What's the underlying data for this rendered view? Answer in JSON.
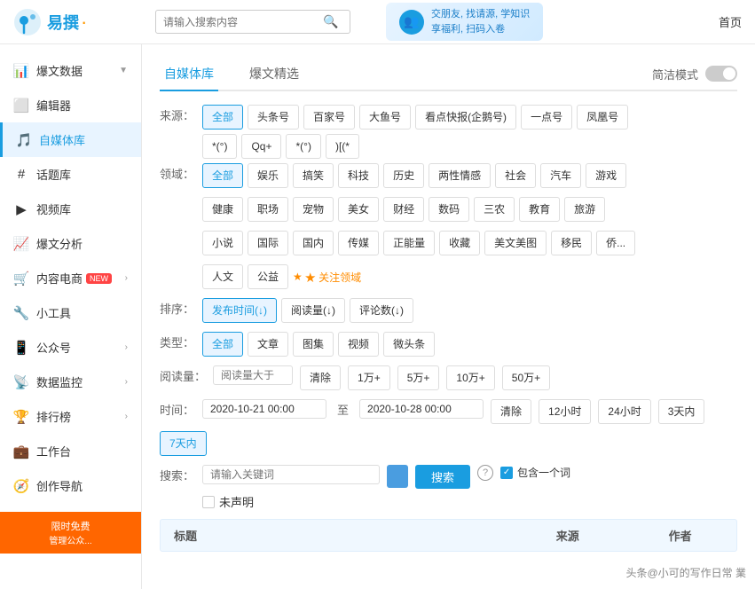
{
  "topbar": {
    "logo_text": "易撰",
    "search_placeholder": "请输入搜索内容",
    "banner_line1": "交朋友, 找请源, 学知识",
    "banner_line2": "享福利, 扫码入卷",
    "home_label": "首页"
  },
  "sidebar": {
    "items": [
      {
        "id": "baowen-data",
        "label": "爆文数据",
        "icon": "📊",
        "arrow": true,
        "active": false
      },
      {
        "id": "bianjiji",
        "label": "编辑器",
        "icon": "✏️",
        "arrow": false,
        "active": false
      },
      {
        "id": "ziwei-tiku",
        "label": "自媒体库",
        "icon": "🎵",
        "arrow": false,
        "active": true
      },
      {
        "id": "huati-ku",
        "label": "话题库",
        "icon": "#",
        "arrow": false,
        "active": false
      },
      {
        "id": "shipin-ku",
        "label": "视频库",
        "icon": "▶",
        "arrow": false,
        "active": false
      },
      {
        "id": "baowen-fenxi",
        "label": "爆文分析",
        "icon": "📈",
        "arrow": false,
        "active": false
      },
      {
        "id": "neirong-dianshang",
        "label": "内容电商",
        "icon": "🛒",
        "badge": "NEW",
        "arrow": true,
        "active": false
      },
      {
        "id": "xiao-gongju",
        "label": "小工具",
        "icon": "",
        "arrow": false,
        "active": false
      },
      {
        "id": "gongzhong-hao",
        "label": "公众号",
        "icon": "",
        "arrow": true,
        "active": false
      },
      {
        "id": "shuju-jiankong",
        "label": "数据监控",
        "icon": "",
        "arrow": true,
        "active": false
      },
      {
        "id": "paihang-bang",
        "label": "排行榜",
        "icon": "",
        "arrow": true,
        "active": false
      },
      {
        "id": "gongzuo-tai",
        "label": "工作台",
        "icon": "",
        "arrow": false,
        "active": false
      },
      {
        "id": "chuangzuo-daohang",
        "label": "创作导航",
        "icon": "",
        "arrow": false,
        "active": false
      }
    ]
  },
  "content": {
    "tabs": [
      {
        "id": "ziwei-tiku-tab",
        "label": "自媒体库",
        "active": true
      },
      {
        "id": "baowen-jingxuan-tab",
        "label": "爆文精选",
        "active": false
      },
      {
        "id": "jianjie-moshi-tab",
        "label": "简洁模式",
        "active": false,
        "toggle": true
      }
    ],
    "source_label": "来源：",
    "sources": [
      {
        "id": "all",
        "label": "全部",
        "active": true
      },
      {
        "id": "toutiao",
        "label": "头条号",
        "active": false
      },
      {
        "id": "baijiahao",
        "label": "百家号",
        "active": false
      },
      {
        "id": "dayu",
        "label": "大鱼号",
        "active": false
      },
      {
        "id": "kandian",
        "label": "看点快报(企鹅号)",
        "active": false
      },
      {
        "id": "yidian",
        "label": "一点号",
        "active": false
      },
      {
        "id": "fenghuang",
        "label": "凤凰号",
        "active": false
      },
      {
        "id": "weibo",
        "label": "*(°)",
        "active": false
      },
      {
        "id": "qq",
        "label": "Qq+",
        "active": false
      },
      {
        "id": "weixing",
        "label": "*(°)",
        "active": false
      },
      {
        "id": "other",
        "label": ")[(*",
        "active": false
      }
    ],
    "domain_label": "领域：",
    "domains_row1": [
      {
        "id": "all",
        "label": "全部",
        "active": true
      },
      {
        "id": "yule",
        "label": "娱乐",
        "active": false
      },
      {
        "id": "gaoxiao",
        "label": "搞笑",
        "active": false
      },
      {
        "id": "keji",
        "label": "科技",
        "active": false
      },
      {
        "id": "lishi",
        "label": "历史",
        "active": false
      },
      {
        "id": "liangxing",
        "label": "两性情感",
        "active": false
      },
      {
        "id": "shehui",
        "label": "社会",
        "active": false
      },
      {
        "id": "qiche",
        "label": "汽车",
        "active": false
      },
      {
        "id": "youxi",
        "label": "游戏",
        "active": false
      }
    ],
    "domains_row2": [
      {
        "id": "jiankang",
        "label": "健康",
        "active": false
      },
      {
        "id": "zhichang",
        "label": "职场",
        "active": false
      },
      {
        "id": "chongwu",
        "label": "宠物",
        "active": false
      },
      {
        "id": "meinv",
        "label": "美女",
        "active": false
      },
      {
        "id": "caijing",
        "label": "财经",
        "active": false
      },
      {
        "id": "shuma",
        "label": "数码",
        "active": false
      },
      {
        "id": "sannong",
        "label": "三农",
        "active": false
      },
      {
        "id": "jiaoyu",
        "label": "教育",
        "active": false
      },
      {
        "id": "lvyou",
        "label": "旅游",
        "active": false
      }
    ],
    "domains_row3": [
      {
        "id": "xiaoshuo",
        "label": "小说",
        "active": false
      },
      {
        "id": "guoji",
        "label": "国际",
        "active": false
      },
      {
        "id": "guonei",
        "label": "国内",
        "active": false
      },
      {
        "id": "chuanmei",
        "label": "传媒",
        "active": false
      },
      {
        "id": "zhengneng",
        "label": "正能量",
        "active": false
      },
      {
        "id": "shoucang",
        "label": "收藏",
        "active": false
      },
      {
        "id": "meinvmei",
        "label": "美文美图",
        "active": false
      },
      {
        "id": "yimin",
        "label": "移民",
        "active": false
      },
      {
        "id": "qinzi",
        "label": "侨...",
        "active": false
      }
    ],
    "domains_row4": [
      {
        "id": "renwen",
        "label": "人文",
        "active": false
      },
      {
        "id": "gongyi",
        "label": "公益",
        "active": false
      }
    ],
    "focus_domain_label": "★ 关注领域",
    "sort_label": "排序：",
    "sorts": [
      {
        "id": "publish-time",
        "label": "发布时间(↓)",
        "active": true
      },
      {
        "id": "read-count",
        "label": "阅读量(↓)",
        "active": false
      },
      {
        "id": "comment-count",
        "label": "评论数(↓)",
        "active": false
      }
    ],
    "type_label": "类型：",
    "types": [
      {
        "id": "all",
        "label": "全部",
        "active": true
      },
      {
        "id": "article",
        "label": "文章",
        "active": false
      },
      {
        "id": "gallery",
        "label": "图集",
        "active": false
      },
      {
        "id": "video",
        "label": "视频",
        "active": false
      },
      {
        "id": "weivideo",
        "label": "微头条",
        "active": false
      }
    ],
    "read_label": "阅读量：",
    "read_placeholder": "阅读量大于",
    "read_clears": [
      {
        "id": "clear",
        "label": "清除"
      },
      {
        "id": "1w",
        "label": "1万+"
      },
      {
        "id": "5w",
        "label": "5万+"
      },
      {
        "id": "10w",
        "label": "10万+"
      },
      {
        "id": "50w",
        "label": "50万+"
      }
    ],
    "time_label": "时间：",
    "time_start": "2020-10-21 00:00",
    "time_end": "2020-10-28 00:00",
    "time_clears": [
      {
        "id": "clear",
        "label": "清除"
      },
      {
        "id": "12h",
        "label": "12小时"
      },
      {
        "id": "24h",
        "label": "24小时"
      },
      {
        "id": "3d",
        "label": "3天内"
      },
      {
        "id": "7d",
        "label": "7天内",
        "active": true
      }
    ],
    "search_label": "搜索：",
    "search_placeholder": "请输入关键词",
    "search_btn": "搜索",
    "include_one_word": "包含一个词",
    "undeclared": "未声明",
    "table_headers": [
      {
        "id": "title",
        "label": "标题"
      },
      {
        "id": "source",
        "label": "来源"
      },
      {
        "id": "author",
        "label": "作者"
      }
    ]
  },
  "watermark": {
    "text": "头条@小可的写作日常 業"
  }
}
